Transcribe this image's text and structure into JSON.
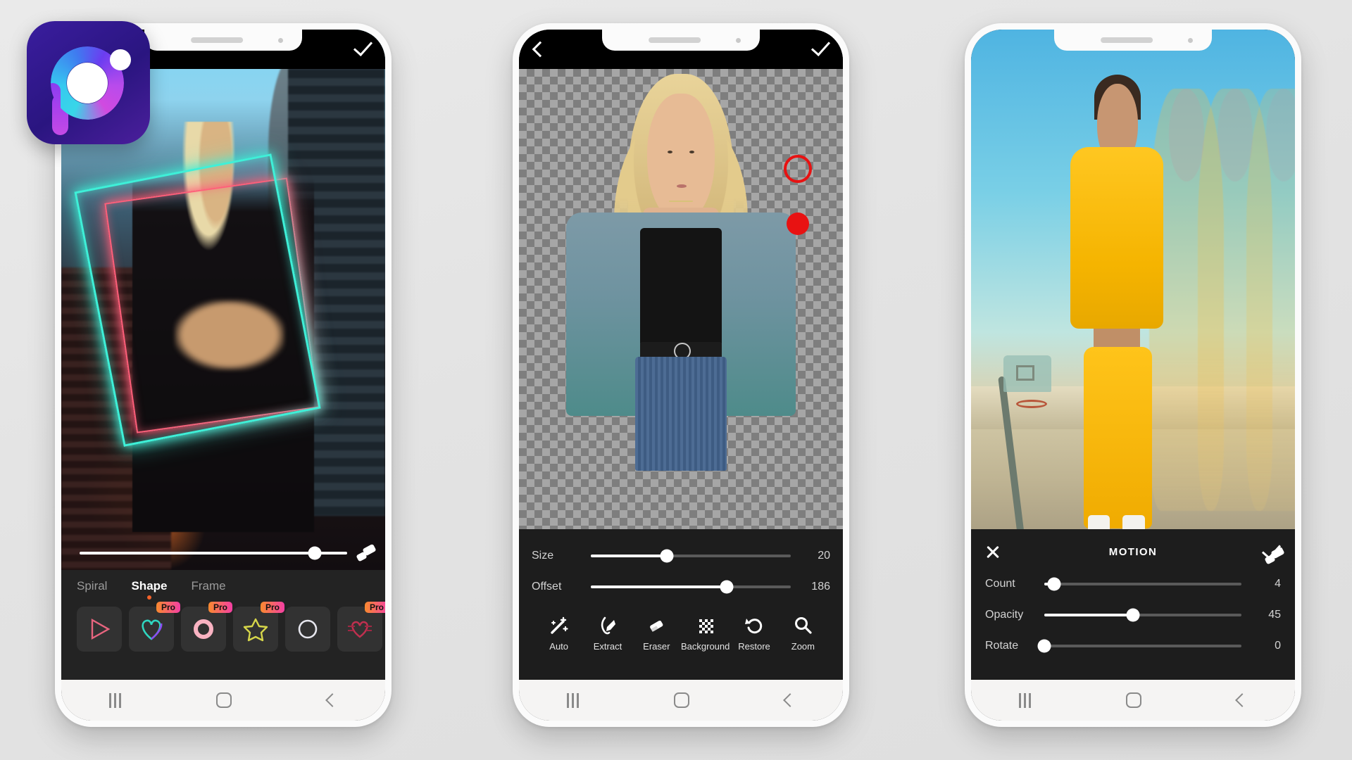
{
  "app": {
    "logo_name": "picsart-logo",
    "background_color": "#e5e5e5"
  },
  "phones": [
    {
      "id": "phone-1",
      "screen_name": "neon-shape-editor",
      "topbar": {
        "confirm_icon": "check-icon"
      },
      "photo_alt": "woman-in-city-with-neon-frame",
      "slider": {
        "name": "opacity-slider",
        "value_pct": 88
      },
      "eraser_icon": "eraser-icon",
      "tabs": [
        {
          "label": "Spiral",
          "active": false
        },
        {
          "label": "Shape",
          "active": true
        },
        {
          "label": "Frame",
          "active": false
        }
      ],
      "thumbnails": [
        {
          "shape": "triangle",
          "pro": false,
          "pro_label": "Pro",
          "color": "#e8657f"
        },
        {
          "shape": "heart",
          "pro": true,
          "pro_label": "Pro",
          "color": "#2fd6c0"
        },
        {
          "shape": "circle",
          "pro": true,
          "pro_label": "Pro",
          "color": "#f7a8b8"
        },
        {
          "shape": "star",
          "pro": true,
          "pro_label": "Pro",
          "color": "#d6d64a"
        },
        {
          "shape": "ring",
          "pro": false,
          "pro_label": "Pro",
          "color": "#e4e4ec"
        },
        {
          "shape": "heart-streak",
          "pro": true,
          "pro_label": "Pro",
          "color": "#c0304f"
        }
      ],
      "navbar": {
        "recents": "recents-icon",
        "home": "home-icon",
        "back": "back-icon"
      }
    },
    {
      "id": "phone-2",
      "screen_name": "cutout-background-remover",
      "topbar": {
        "back_icon": "back-chevron-icon",
        "confirm_icon": "check-icon"
      },
      "photo_alt": "blonde-woman-cutout-on-transparent-checkerboard",
      "markers": [
        {
          "name": "brush-size-ring",
          "color": "#e81212",
          "type": "outline"
        },
        {
          "name": "brush-size-dot",
          "color": "#e81212",
          "type": "filled"
        }
      ],
      "sliders": [
        {
          "label": "Size",
          "value": "20",
          "fill_pct": 38
        },
        {
          "label": "Offset",
          "value": "186",
          "fill_pct": 68
        }
      ],
      "tools": [
        {
          "label": "Auto",
          "icon": "magic-wand-icon"
        },
        {
          "label": "Extract",
          "icon": "lasso-pen-icon"
        },
        {
          "label": "Eraser",
          "icon": "eraser-icon"
        },
        {
          "label": "Background",
          "icon": "checkerboard-icon"
        },
        {
          "label": "Restore",
          "icon": "restore-undo-icon"
        },
        {
          "label": "Zoom",
          "icon": "magnifier-icon"
        }
      ],
      "navbar": {
        "recents": "recents-icon",
        "home": "home-icon",
        "back": "back-icon"
      }
    },
    {
      "id": "phone-3",
      "screen_name": "motion-effect-editor",
      "photo_alt": "woman-in-yellow-tracksuit-with-motion-echo",
      "eraser_icon": "eraser-icon",
      "panel": {
        "title": "MOTION",
        "close_icon": "close-x-icon",
        "confirm_icon": "check-icon",
        "accent_color": "#f4622a",
        "sliders": [
          {
            "label": "Count",
            "value": "4",
            "fill_pct": 5
          },
          {
            "label": "Opacity",
            "value": "45",
            "fill_pct": 45
          },
          {
            "label": "Rotate",
            "value": "0",
            "fill_pct": 0
          }
        ]
      },
      "navbar": {
        "recents": "recents-icon",
        "home": "home-icon",
        "back": "back-icon"
      }
    }
  ]
}
